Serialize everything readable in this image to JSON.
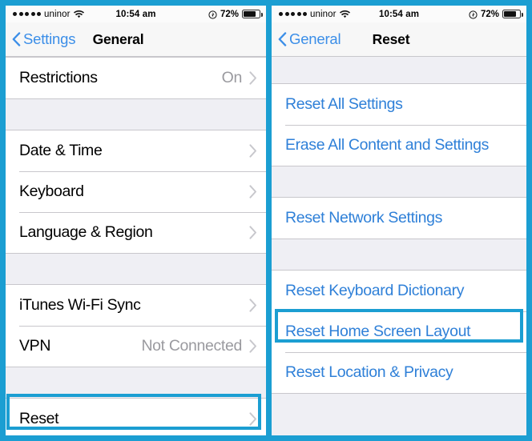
{
  "accent": {
    "highlight_blue": "#1b9ed2",
    "link_blue": "#2f80d8",
    "nav_blue": "#3b8ee8",
    "value_gray": "#9a9a9f",
    "group_bg": "#efeff4"
  },
  "panels": [
    {
      "id": "general",
      "status_bar": {
        "signal_dots": 5,
        "carrier": "uninor",
        "wifi_icon": "wifi-icon",
        "time": "10:54 am",
        "location_icon": "location-services-icon",
        "battery_percent": "72%",
        "battery_level": 72,
        "battery_icon": "battery-icon"
      },
      "nav": {
        "back_icon": "chevron-left-icon",
        "back_label": "Settings",
        "title": "General"
      },
      "groups": [
        {
          "rows": [
            {
              "label": "Restrictions",
              "value": "On",
              "chevron": true,
              "style": "dark"
            }
          ]
        },
        {
          "rows": [
            {
              "label": "Date & Time",
              "value": "",
              "chevron": true,
              "style": "dark"
            },
            {
              "label": "Keyboard",
              "value": "",
              "chevron": true,
              "style": "dark"
            },
            {
              "label": "Language & Region",
              "value": "",
              "chevron": true,
              "style": "dark"
            }
          ]
        },
        {
          "rows": [
            {
              "label": "iTunes Wi-Fi Sync",
              "value": "",
              "chevron": true,
              "style": "dark"
            },
            {
              "label": "VPN",
              "value": "Not Connected",
              "chevron": true,
              "style": "dark"
            }
          ]
        },
        {
          "rows": [
            {
              "label": "Reset",
              "value": "",
              "chevron": true,
              "style": "dark"
            }
          ]
        }
      ],
      "highlight": "Reset"
    },
    {
      "id": "reset",
      "status_bar": {
        "signal_dots": 5,
        "carrier": "uninor",
        "wifi_icon": "wifi-icon",
        "time": "10:54 am",
        "location_icon": "location-services-icon",
        "battery_percent": "72%",
        "battery_level": 72,
        "battery_icon": "battery-icon"
      },
      "nav": {
        "back_icon": "chevron-left-icon",
        "back_label": "General",
        "title": "Reset"
      },
      "groups": [
        {
          "rows": [
            {
              "label": "Reset All Settings",
              "value": "",
              "chevron": false,
              "style": "blue"
            },
            {
              "label": "Erase All Content and Settings",
              "value": "",
              "chevron": false,
              "style": "blue"
            }
          ]
        },
        {
          "rows": [
            {
              "label": "Reset Network Settings",
              "value": "",
              "chevron": false,
              "style": "blue"
            }
          ]
        },
        {
          "rows": [
            {
              "label": "Reset Keyboard Dictionary",
              "value": "",
              "chevron": false,
              "style": "blue"
            },
            {
              "label": "Reset Home Screen Layout",
              "value": "",
              "chevron": false,
              "style": "blue"
            },
            {
              "label": "Reset Location & Privacy",
              "value": "",
              "chevron": false,
              "style": "blue"
            }
          ]
        }
      ],
      "highlight": "Reset Home Screen Layout"
    }
  ]
}
